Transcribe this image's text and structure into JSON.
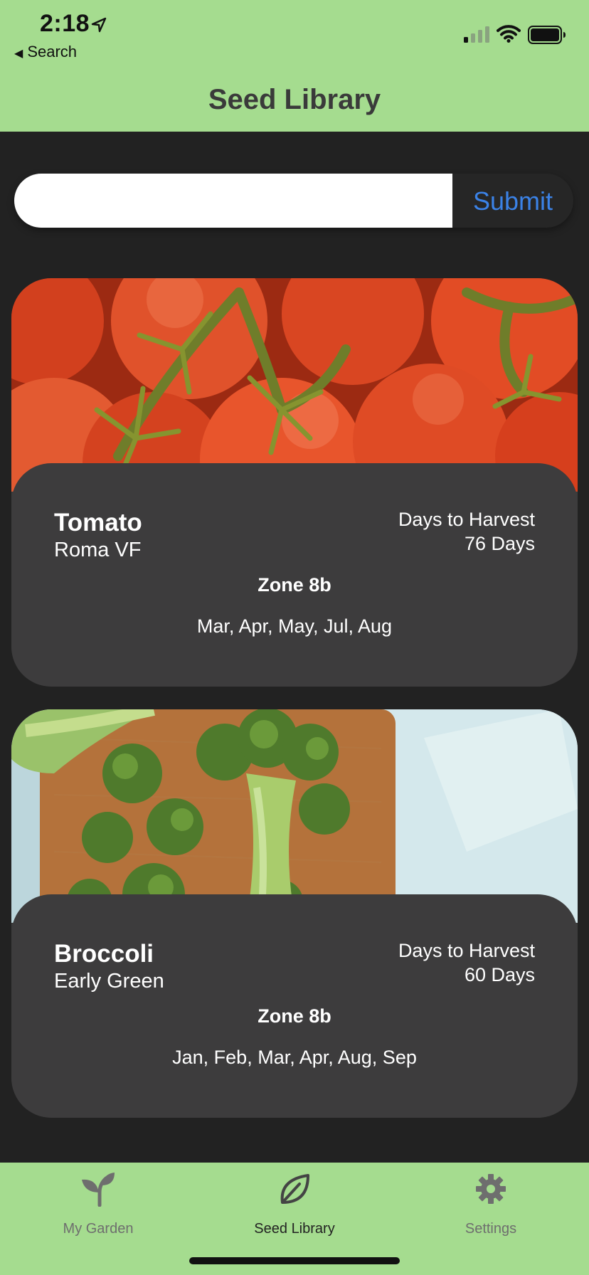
{
  "status_bar": {
    "time": "2:18",
    "back_label": "Search"
  },
  "nav": {
    "title": "Seed Library"
  },
  "search": {
    "value": "",
    "placeholder": "",
    "submit_label": "Submit"
  },
  "cards": [
    {
      "name": "Tomato",
      "variety": "Roma VF",
      "harvest_label": "Days to Harvest",
      "harvest_value": "76 Days",
      "zone": "Zone 8b",
      "months": "Mar, Apr, May, Jul, Aug"
    },
    {
      "name": "Broccoli",
      "variety": "Early Green",
      "harvest_label": "Days to Harvest",
      "harvest_value": "60 Days",
      "zone": "Zone 8b",
      "months": "Jan, Feb, Mar, Apr, Aug, Sep"
    }
  ],
  "tab_bar": {
    "tabs": [
      {
        "label": "My Garden",
        "icon": "sprout-icon"
      },
      {
        "label": "Seed Library",
        "icon": "leaf-icon"
      },
      {
        "label": "Settings",
        "icon": "gear-icon"
      }
    ],
    "active_index": 1
  },
  "colors": {
    "accent_green": "#a5dc8f",
    "background": "#222222",
    "card": "#3d3c3d",
    "link_blue": "#3b82e6"
  }
}
